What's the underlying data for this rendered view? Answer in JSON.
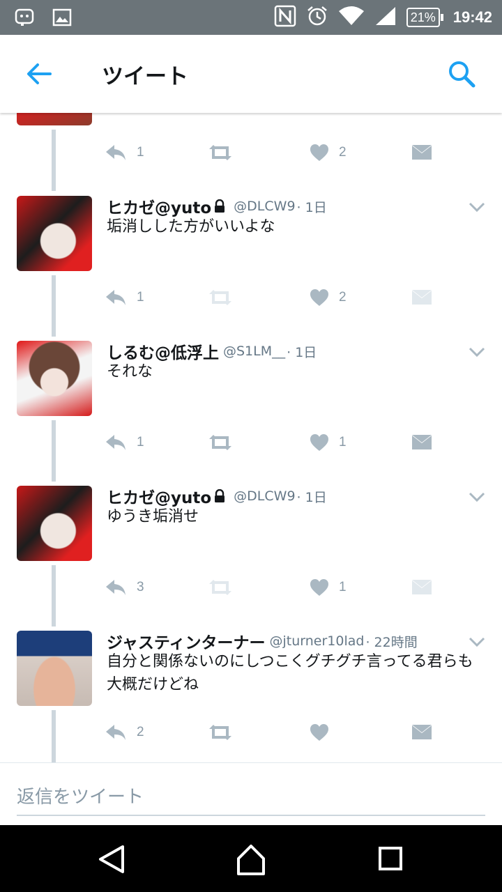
{
  "status_bar": {
    "battery_label": "21%",
    "time": "19:42",
    "icons": [
      "chat-bubble-icon",
      "image-icon",
      "nfc-icon",
      "alarm-icon",
      "wifi-icon",
      "signal-icon",
      "battery-icon"
    ]
  },
  "header": {
    "title": "ツイート",
    "back_icon": "arrow-left-icon",
    "search_icon": "search-icon",
    "accent_color": "#1da1f2"
  },
  "top_partial_actions": {
    "reply_count": "1",
    "retweet_count": "",
    "like_count": "2"
  },
  "tweets": [
    {
      "name": "ヒカゼ@yuto",
      "protected": true,
      "handle": "@DLCW9",
      "time": "· 1日",
      "text": "垢消しした方がいいよな",
      "reply_count": "1",
      "like_count": "2"
    },
    {
      "name": "しるむ@低浮上",
      "protected": false,
      "handle": "@S1LM__",
      "time": "· 1日",
      "text": "それな",
      "reply_count": "1",
      "like_count": "1"
    },
    {
      "name": "ヒカゼ@yuto",
      "protected": true,
      "handle": "@DLCW9",
      "time": "· 1日",
      "text": "ゆうき垢消せ",
      "reply_count": "3",
      "like_count": "1"
    },
    {
      "name": "ジャスティンターナー",
      "protected": false,
      "handle": "@jturner10lad",
      "time": "· 22時間",
      "text": "自分と関係ないのにしつこくグチグチ言ってる君らも大概だけどね",
      "reply_count": "2",
      "like_count": ""
    }
  ],
  "compose": {
    "placeholder": "返信をツイート"
  }
}
